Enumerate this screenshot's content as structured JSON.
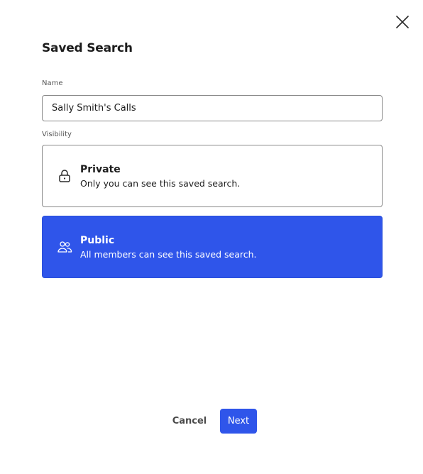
{
  "dialog": {
    "title": "Saved Search",
    "close_icon": "close-icon"
  },
  "form": {
    "name_label": "Name",
    "name_value": "Sally Smith's Calls",
    "visibility_label": "Visibility"
  },
  "visibility_options": [
    {
      "id": "private",
      "icon": "lock-icon",
      "title": "Private",
      "description": "Only you can see this saved search.",
      "selected": false
    },
    {
      "id": "public",
      "icon": "users-icon",
      "title": "Public",
      "description": "All members can see this saved search.",
      "selected": true
    }
  ],
  "actions": {
    "cancel_label": "Cancel",
    "next_label": "Next"
  },
  "colors": {
    "accent": "#2f55ea",
    "border": "#8a8a8a",
    "text": "#1c1c1c"
  }
}
